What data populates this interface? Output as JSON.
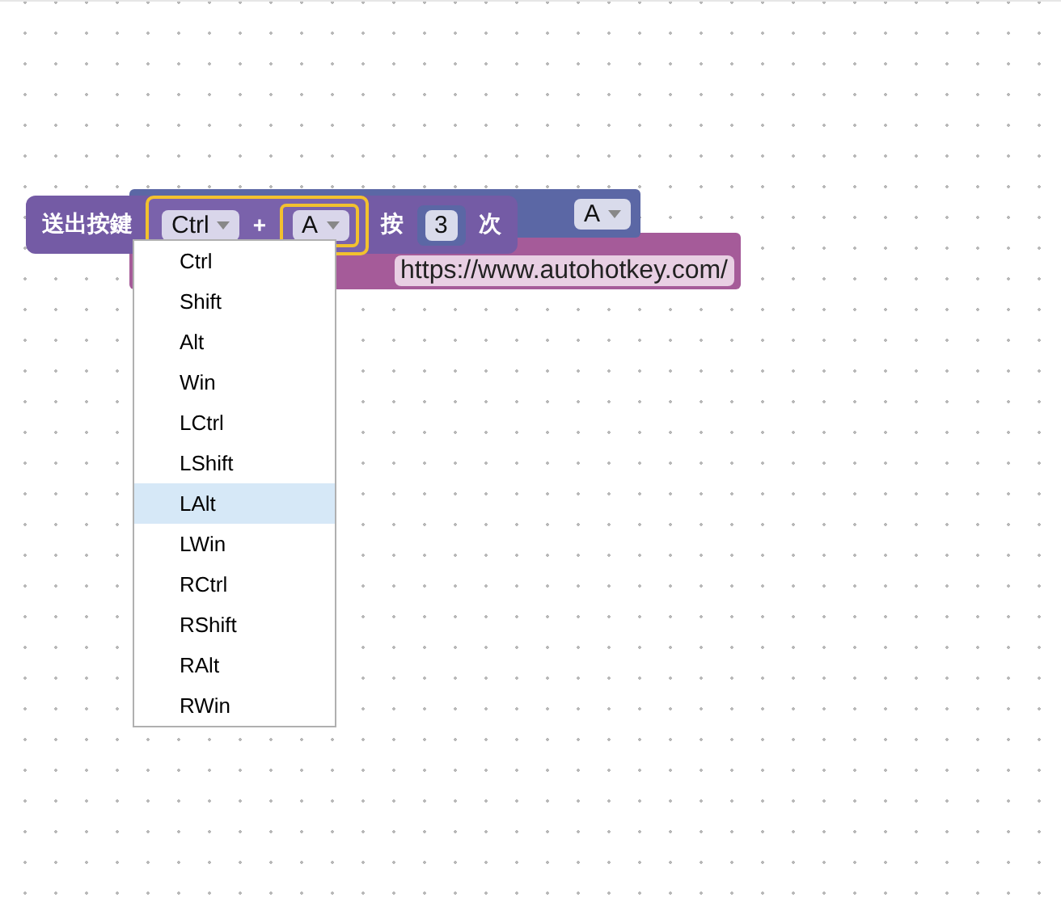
{
  "block": {
    "label": "送出按鍵",
    "modifier": "Ctrl",
    "plus": "+",
    "key": "A",
    "press_label": "按",
    "count": "3",
    "times_label": "次"
  },
  "back_block": {
    "key": "A"
  },
  "url_block": {
    "url": "https://www.autohotkey.com/"
  },
  "menu": {
    "items": [
      {
        "label": "Ctrl",
        "selected": false
      },
      {
        "label": "Shift",
        "selected": false
      },
      {
        "label": "Alt",
        "selected": false
      },
      {
        "label": "Win",
        "selected": false
      },
      {
        "label": "LCtrl",
        "selected": false
      },
      {
        "label": "LShift",
        "selected": false
      },
      {
        "label": "LAlt",
        "selected": true
      },
      {
        "label": "LWin",
        "selected": false
      },
      {
        "label": "RCtrl",
        "selected": false
      },
      {
        "label": "RShift",
        "selected": false
      },
      {
        "label": "RAlt",
        "selected": false
      },
      {
        "label": "RWin",
        "selected": false
      }
    ]
  }
}
